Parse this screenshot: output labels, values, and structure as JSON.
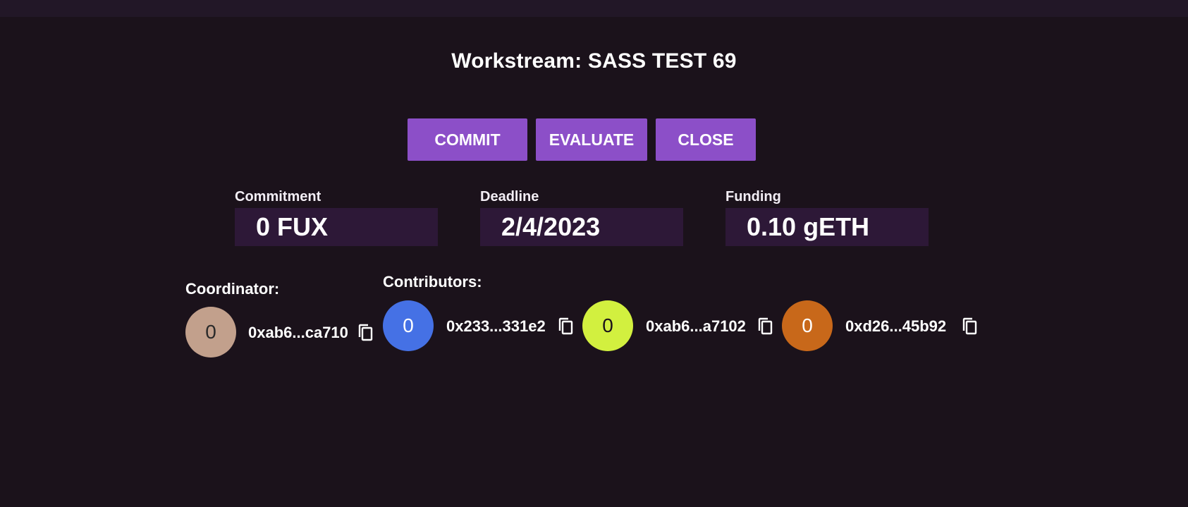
{
  "header": {
    "title": "Workstream: SASS TEST 69"
  },
  "actions": {
    "commit_label": "COMMIT",
    "evaluate_label": "EVALUATE",
    "close_label": "CLOSE"
  },
  "stats": {
    "commitment": {
      "label": "Commitment",
      "value": "0 FUX"
    },
    "deadline": {
      "label": "Deadline",
      "value": "2/4/2023"
    },
    "funding": {
      "label": "Funding",
      "value": "0.10 gETH"
    }
  },
  "coordinator": {
    "label": "Coordinator:",
    "avatar_text": "0",
    "avatar_color": "#c2a08c",
    "address": "0xab6...ca710",
    "copy_icon": "copy-icon"
  },
  "contributors": {
    "label": "Contributors:",
    "items": [
      {
        "avatar_text": "0",
        "avatar_color": "#4571e5",
        "address": "0x233...331e2"
      },
      {
        "avatar_text": "0",
        "avatar_color": "#d2f03f",
        "address": "0xab6...a7102"
      },
      {
        "avatar_text": "0",
        "avatar_color": "#c8681a",
        "address": "0xd26...45b92"
      }
    ]
  },
  "colors": {
    "background": "#1b121b",
    "topbar": "#221727",
    "button": "#8c4fc8",
    "stat_box": "#2d1837"
  }
}
